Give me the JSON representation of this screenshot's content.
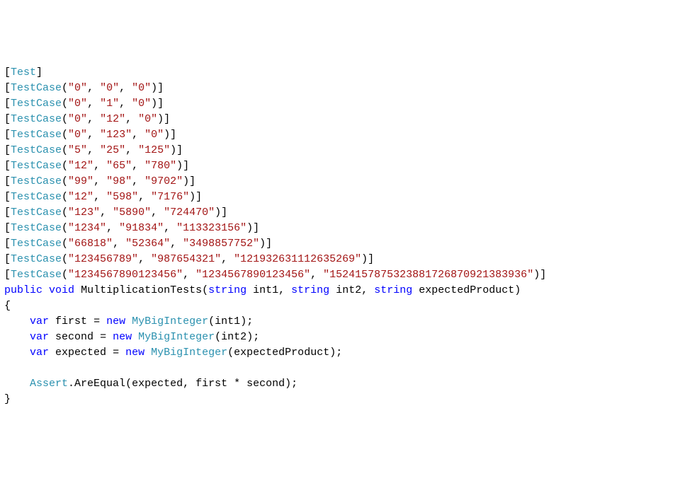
{
  "code": {
    "L0_attr": "Test",
    "L1_attr": "TestCase",
    "L1_s1": "\"0\"",
    "L1_s2": "\"0\"",
    "L1_s3": "\"0\"",
    "L2_attr": "TestCase",
    "L2_s1": "\"0\"",
    "L2_s2": "\"1\"",
    "L2_s3": "\"0\"",
    "L3_attr": "TestCase",
    "L3_s1": "\"0\"",
    "L3_s2": "\"12\"",
    "L3_s3": "\"0\"",
    "L4_attr": "TestCase",
    "L4_s1": "\"0\"",
    "L4_s2": "\"123\"",
    "L4_s3": "\"0\"",
    "L5_attr": "TestCase",
    "L5_s1": "\"5\"",
    "L5_s2": "\"25\"",
    "L5_s3": "\"125\"",
    "L6_attr": "TestCase",
    "L6_s1": "\"12\"",
    "L6_s2": "\"65\"",
    "L6_s3": "\"780\"",
    "L7_attr": "TestCase",
    "L7_s1": "\"99\"",
    "L7_s2": "\"98\"",
    "L7_s3": "\"9702\"",
    "L8_attr": "TestCase",
    "L8_s1": "\"12\"",
    "L8_s2": "\"598\"",
    "L8_s3": "\"7176\"",
    "L9_attr": "TestCase",
    "L9_s1": "\"123\"",
    "L9_s2": "\"5890\"",
    "L9_s3": "\"724470\"",
    "L10_attr": "TestCase",
    "L10_s1": "\"1234\"",
    "L10_s2": "\"91834\"",
    "L10_s3": "\"113323156\"",
    "L11_attr": "TestCase",
    "L11_s1": "\"66818\"",
    "L11_s2": "\"52364\"",
    "L11_s3": "\"3498857752\"",
    "L12_attr": "TestCase",
    "L12_s1": "\"123456789\"",
    "L12_s2": "\"987654321\"",
    "L12_s3": "\"121932631112635269\"",
    "L13_attr": "TestCase",
    "L13_s1": "\"1234567890123456\"",
    "L13_s2": "\"1234567890123456\"",
    "L13_s3": "\"1524157875323881726870921383936\"",
    "kw_public": "public",
    "kw_void": "void",
    "method_name": "MultiplicationTests",
    "kw_string1": "string",
    "param1": "int1",
    "kw_string2": "string",
    "param2": "int2",
    "kw_string3": "string",
    "param3": "expectedProduct",
    "brace_open": "{",
    "kw_var1": "var",
    "var1": "first",
    "kw_new1": "new",
    "type_BigInt": "MyBigInteger",
    "arg1": "int1",
    "kw_var2": "var",
    "var2": "second",
    "kw_new2": "new",
    "arg2": "int2",
    "kw_var3": "var",
    "var3": "expected",
    "kw_new3": "new",
    "arg3": "expectedProduct",
    "assert_cls": "Assert",
    "assert_method": "AreEqual",
    "assert_a1": "expected",
    "assert_a2": "first",
    "assert_a3": "second",
    "brace_close": "}"
  }
}
